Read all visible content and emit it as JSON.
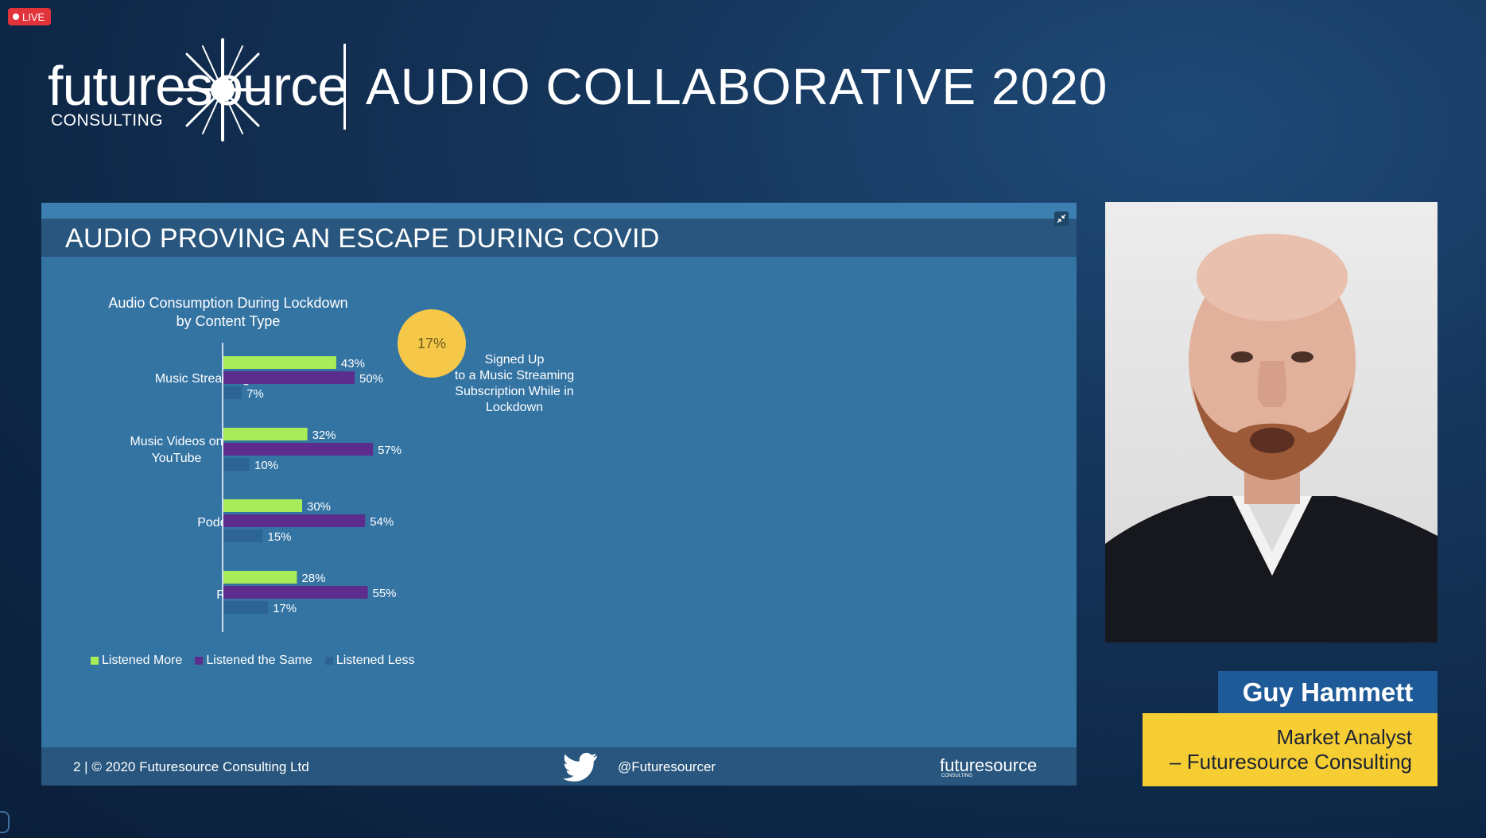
{
  "live_badge": "LIVE",
  "header": {
    "logo_word": "futuresource",
    "logo_sub": "CONSULTING",
    "title": "AUDIO COLLABORATIVE 2020"
  },
  "slide": {
    "title": "AUDIO PROVING AN ESCAPE DURING COVID",
    "callout_value": "17%",
    "callout_lines": [
      "Signed Up",
      "to a Music Streaming",
      "Subscription While in",
      "Lockdown"
    ],
    "footer_copy": "2  |  © 2020 Futuresource Consulting Ltd",
    "footer_handle": "@Futuresourcer",
    "footer_logo_word": "futuresource",
    "footer_logo_sub": "CONSULTING"
  },
  "chart_data": {
    "type": "bar",
    "orientation": "horizontal",
    "title": "Audio Consumption During Lockdown by Content Type",
    "categories": [
      "Music Streaming",
      "Music Videos on YouTube",
      "Podcasts",
      "Radio"
    ],
    "series": [
      {
        "name": "Listened More",
        "color": "#a8ec5a",
        "values": [
          43,
          32,
          30,
          28
        ],
        "labels": [
          "43%",
          "32%",
          "30%",
          "28%"
        ]
      },
      {
        "name": "Listened the Same",
        "color": "#5c2d8c",
        "values": [
          50,
          57,
          54,
          55
        ],
        "labels": [
          "50%",
          "57%",
          "54%",
          "55%"
        ]
      },
      {
        "name": "Listened Less",
        "color": "#2c6495",
        "values": [
          7,
          10,
          15,
          17
        ],
        "labels": [
          "7%",
          "10%",
          "15%",
          "17%"
        ]
      }
    ],
    "legend_position": "bottom",
    "grid": false
  },
  "presenter": {
    "name": "Guy Hammett",
    "role_lines": [
      "Market Analyst",
      "– Futuresource Consulting"
    ]
  },
  "colors": {
    "live": "#e0343a",
    "name_box": "#1e5a97",
    "role_box": "#f7cd34",
    "slide_bg": "#3474a3",
    "callout": "#f5c84a"
  }
}
